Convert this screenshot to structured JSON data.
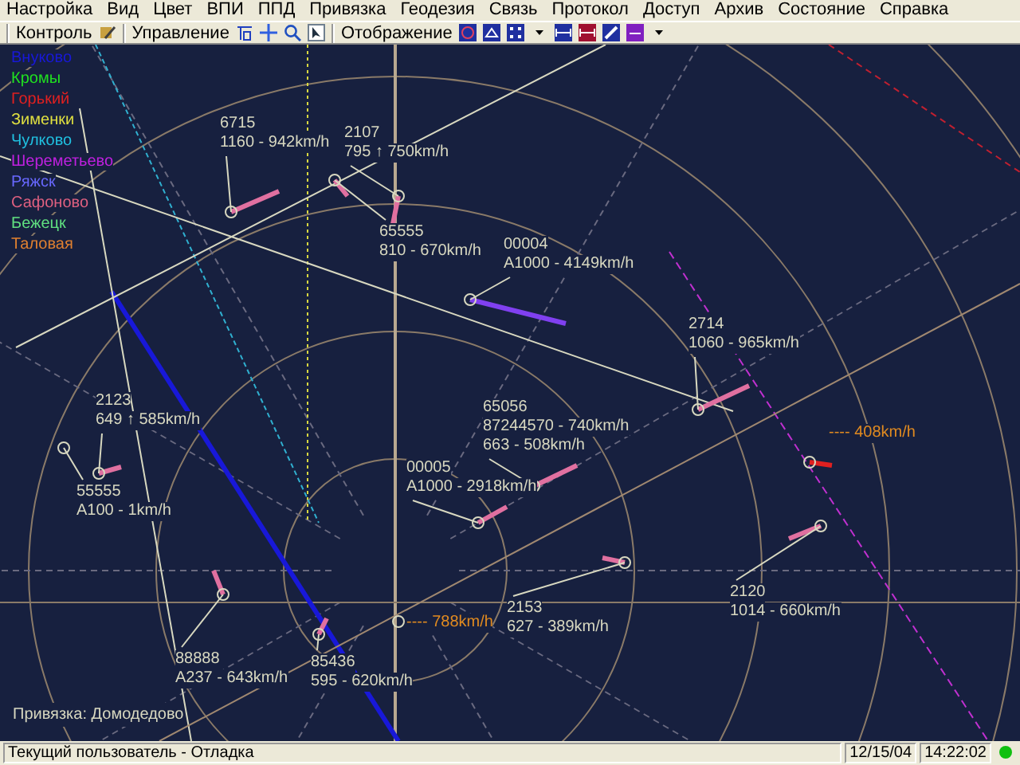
{
  "menu": [
    "Настройка",
    "Вид",
    "Цвет",
    "ВПИ",
    "ППД",
    "Привязка",
    "Геодезия",
    "Связь",
    "Протокол",
    "Доступ",
    "Архив",
    "Состояние",
    "Справка"
  ],
  "toolbar": [
    {
      "label": "Контроль"
    },
    {
      "label": "Управление"
    },
    {
      "label": "Отображение"
    }
  ],
  "legend": [
    {
      "label": "Внуково",
      "color": "#1818d8"
    },
    {
      "label": "Кромы",
      "color": "#20e020"
    },
    {
      "label": "Горький",
      "color": "#e02020"
    },
    {
      "label": "Зименки",
      "color": "#e0e040"
    },
    {
      "label": "Чулково",
      "color": "#20c0e0"
    },
    {
      "label": "Шереметьево",
      "color": "#c020e0"
    },
    {
      "label": "Ряжск",
      "color": "#6868ff"
    },
    {
      "label": "Сафоново",
      "color": "#e06080"
    },
    {
      "label": "Бежецк",
      "color": "#60e080"
    },
    {
      "label": "Таловая",
      "color": "#e08030"
    }
  ],
  "tracks": [
    {
      "kind": "track",
      "lines": [
        "6715",
        "1160 - 942km/h"
      ]
    },
    {
      "kind": "track",
      "lines": [
        "2107",
        "795 ↑ 750km/h"
      ]
    },
    {
      "kind": "track",
      "lines": [
        "65555",
        "810 - 670km/h"
      ]
    },
    {
      "kind": "track",
      "lines": [
        "00004",
        "A1000 - 4149km/h"
      ]
    },
    {
      "kind": "track",
      "lines": [
        "2714",
        "1060 - 965km/h"
      ]
    },
    {
      "kind": "track",
      "lines": [
        "2123",
        "649 ↑ 585km/h"
      ]
    },
    {
      "kind": "track",
      "lines": [
        "65056",
        "87244570 - 740km/h",
        "663 - 508km/h"
      ]
    },
    {
      "kind": "track",
      "lines": [
        "00005",
        "A1000 - 2918km/h"
      ]
    },
    {
      "kind": "track",
      "lines": [
        "55555",
        "A100 - 1km/h"
      ]
    },
    {
      "kind": "track",
      "lines": [
        "2153",
        "627 - 389km/h"
      ]
    },
    {
      "kind": "track",
      "lines": [
        "2120",
        "1014 - 660km/h"
      ]
    },
    {
      "kind": "track",
      "lines": [
        "88888",
        "A237 - 643km/h"
      ]
    },
    {
      "kind": "track",
      "lines": [
        "85436",
        "595 - 620km/h"
      ]
    },
    {
      "kind": "estimate",
      "lines": [
        "---- 408km/h"
      ]
    },
    {
      "kind": "estimate",
      "lines": [
        "---- 788km/h"
      ]
    }
  ],
  "binding": "Привязка: Домодедово",
  "status_bar": {
    "user": "Текущий пользователь - Отладка",
    "date": "12/15/04",
    "time": "14:22:02",
    "online": true
  }
}
